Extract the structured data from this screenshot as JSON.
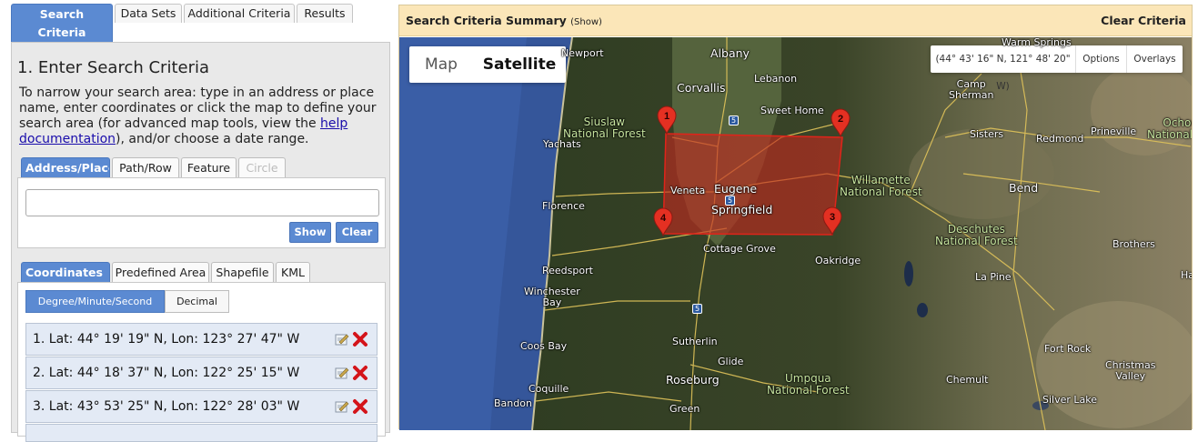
{
  "top_tabs": [
    "Search Criteria",
    "Data Sets",
    "Additional Criteria",
    "Results"
  ],
  "panel": {
    "heading": "1. Enter Search Criteria",
    "intro_pre": "To narrow your search area: type in an address or place name, enter coordinates or click the map to define your search area (for advanced map tools, view the ",
    "intro_link": "help documentation",
    "intro_post": "), and/or choose a date range.",
    "address_tabs": [
      "Address/Place",
      "Path/Row",
      "Feature",
      "Circle"
    ],
    "address_value": "",
    "show_label": "Show",
    "clear_label": "Clear",
    "coord_tabs": [
      "Coordinates",
      "Predefined Area",
      "Shapefile",
      "KML"
    ],
    "format_tabs": [
      "Degree/Minute/Second",
      "Decimal"
    ],
    "coordinates": [
      "1.  Lat: 44° 19' 19\" N, Lon: 123° 27' 47\" W",
      "2.  Lat: 44° 18' 37\" N, Lon: 122° 25' 15\" W",
      "3.  Lat: 43° 53' 25\" N, Lon: 122° 28' 03\" W"
    ]
  },
  "summary": {
    "title": "Search Criteria Summary",
    "show": "(Show)",
    "clear": "Clear Criteria"
  },
  "map": {
    "type_map": "Map",
    "type_satellite": "Satellite",
    "coord_readout": "(44° 43' 16\" N, 121° 48' 20\" W)",
    "options": "Options",
    "overlays": "Overlays",
    "markers": [
      "1",
      "2",
      "3",
      "4"
    ],
    "places": {
      "albany": "Albany",
      "corvallis": "Corvallis",
      "lebanon": "Lebanon",
      "sweet_home": "Sweet Home",
      "newport": "Newport",
      "siuslaw": "Siuslaw\nNational Forest",
      "yachats": "Yachats",
      "florence": "Florence",
      "veneta": "Veneta",
      "eugene": "Eugene",
      "springfield": "Springfield",
      "cottage_grove": "Cottage Grove",
      "oakridge": "Oakridge",
      "willamette": "Willamette\nNational Forest",
      "reedsport": "Reedsport",
      "winchester_bay": "Winchester\nBay",
      "coos_bay": "Coos Bay",
      "sutherlin": "Sutherlin",
      "glide": "Glide",
      "roseburg": "Roseburg",
      "umpqua": "Umpqua\nNational Forest",
      "coquille": "Coquille",
      "bandon": "Bandon",
      "green": "Green",
      "warm_springs": "Warm Springs",
      "camp_sherman": "Camp\nSherman",
      "sisters": "Sisters",
      "redmond": "Redmond",
      "prineville": "Prineville",
      "ochoco": "Ochoco\nNational Fore",
      "bend": "Bend",
      "deschutes": "Deschutes\nNational Forest",
      "brothers": "Brothers",
      "la_pine": "La Pine",
      "fort_rock": "Fort Rock",
      "christmas_valley": "Christmas\nValley",
      "chemult": "Chemult",
      "silver_lake": "Silver Lake",
      "ha": "Ha"
    },
    "shields": [
      "5",
      "5",
      "5"
    ]
  }
}
